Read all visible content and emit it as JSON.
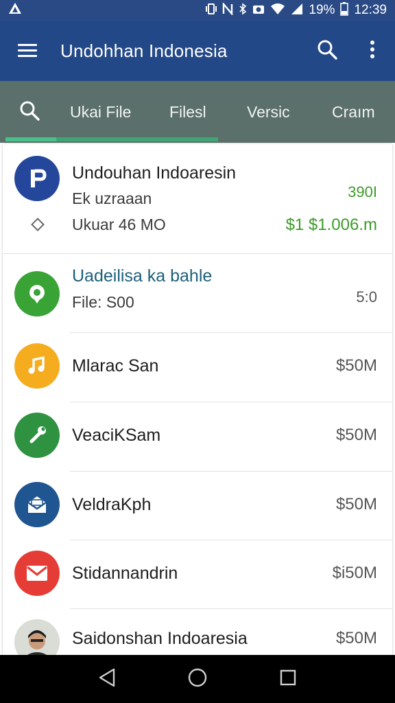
{
  "status_bar": {
    "battery": "19%",
    "time": "12:39"
  },
  "app_bar": {
    "title": "Undohhan Indonesia",
    "icons": [
      "menu-icon",
      "search-icon",
      "more-vert-icon"
    ]
  },
  "tabs": {
    "items": [
      {
        "label": "Ukai File"
      },
      {
        "label": "Filesl"
      },
      {
        "label": "Versic"
      },
      {
        "label": "Craım"
      }
    ],
    "accent": "#3fa575"
  },
  "list": {
    "items": [
      {
        "title": "Undouhan Indoaresin",
        "subtitle": "Ek uzraaan",
        "size": "Ukuar 46 MO",
        "value_top": "390I",
        "value": "$1 $1.006.m",
        "icon": "p-app-icon",
        "color": "#24479b"
      },
      {
        "title": "Uadeilisa ka bahle",
        "subtitle": "File: S00",
        "value": "5:0",
        "icon": "location-pin-icon",
        "color": "#3aa336"
      },
      {
        "title": "Mlarac San",
        "value": "$50M",
        "icon": "music-note-icon",
        "color": "#f6ac1f"
      },
      {
        "title": "VeaciKSam",
        "value": "$50M",
        "icon": "wrench-icon",
        "color": "#2e9240"
      },
      {
        "title": "VeldraKph",
        "value": "$50M",
        "icon": "mail-open-icon",
        "color": "#1f5590"
      },
      {
        "title": "Stidannandrin",
        "value": "$i50M",
        "icon": "gmail-icon",
        "color": "#e53c35"
      },
      {
        "title": "Saidonshan Indoaresia",
        "value": "$50M",
        "icon": "person-avatar-icon",
        "color": "#d9ddd5"
      }
    ]
  },
  "nav_bar": {
    "icons": [
      "back-icon",
      "home-icon",
      "recents-icon"
    ]
  }
}
